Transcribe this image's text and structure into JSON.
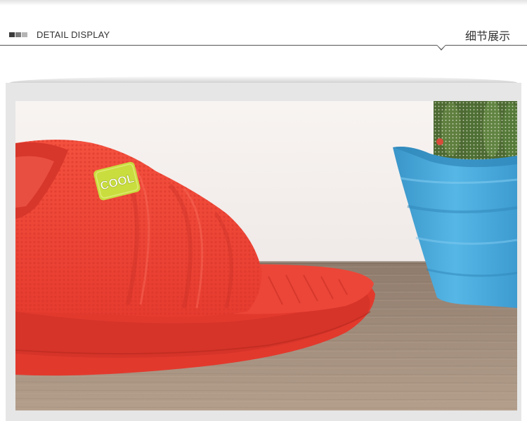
{
  "header": {
    "title_en": "DETAIL DISPLAY",
    "title_cn": "细节展示",
    "square_colors": [
      "#3a3a3a",
      "#7a7a7a",
      "#b5b5b5"
    ]
  },
  "photo": {
    "badge_text": "COOL",
    "colors": {
      "slipper": "#f2473a",
      "slipper_shadow": "#d7362b",
      "badge": "#c9dd3e",
      "pot": "#45a9dc",
      "cactus": "#5b7a3e",
      "table": "#a08a78",
      "wall": "#f6f1ef"
    }
  }
}
